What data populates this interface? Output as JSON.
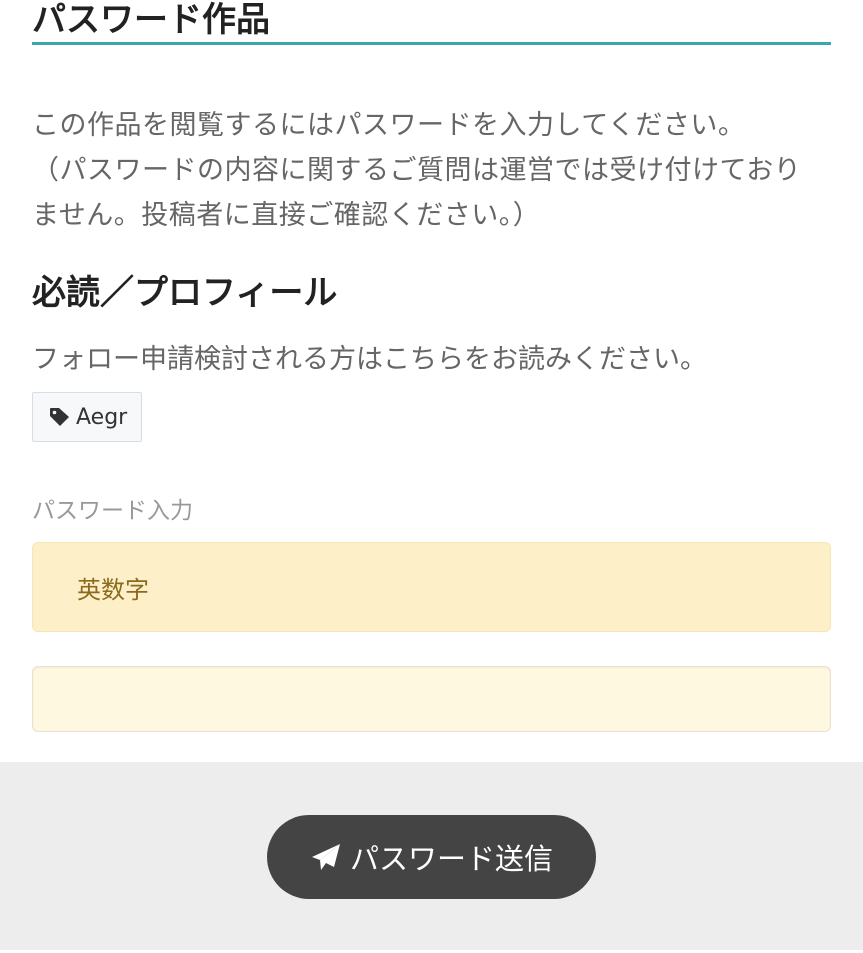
{
  "header": {
    "title": "パスワード作品"
  },
  "notice": {
    "line1": "この作品を閲覧するにはパスワードを入力してください。",
    "line2": "（パスワードの内容に関するご質問は運営では受け付けており",
    "line3": "ません。投稿者に直接ご確認ください。）"
  },
  "work": {
    "title": "必読／プロフィール",
    "description": "フォロー申請検討される方はこちらをお読みください。",
    "tag": "Aegr"
  },
  "password": {
    "label": "パスワード入力",
    "hint": "英数字",
    "value": ""
  },
  "submit": {
    "label": "パスワード送信",
    "icon": "paper-plane-icon"
  },
  "colors": {
    "accent_underline": "#3aa7ab",
    "hint_background": "#fdf0c9",
    "hint_text": "#8a6a1d",
    "input_background": "#fff8e1",
    "button_background": "#444444",
    "footer_background": "#ededed"
  }
}
